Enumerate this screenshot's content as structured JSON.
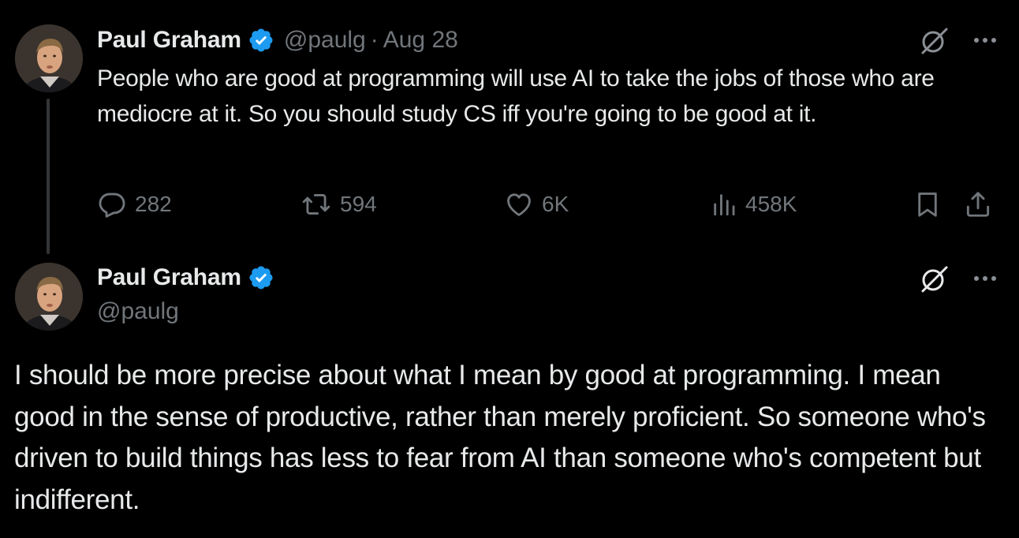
{
  "tweet1": {
    "author_name": "Paul Graham",
    "handle": "@paulg",
    "separator": "·",
    "date": "Aug 28",
    "text": "People who are good at programming will use AI to take the jobs of those who are mediocre at it. So you should study CS iff you're going to be good at it.",
    "stats": {
      "replies": "282",
      "reposts": "594",
      "likes": "6K",
      "views": "458K"
    }
  },
  "tweet2": {
    "author_name": "Paul Graham",
    "handle": "@paulg",
    "text": "I should be more precise about what I mean by good at programming. I mean good in the sense of productive, rather than merely proficient. So someone who's driven to build things has less to fear from AI than someone who's competent but indifferent."
  },
  "icons": {
    "verified": "verified-badge-icon",
    "grok": "grok-icon",
    "more": "more-icon",
    "reply": "reply-icon",
    "repost": "repost-icon",
    "like": "heart-icon",
    "views": "views-icon",
    "bookmark": "bookmark-icon",
    "share": "share-icon"
  },
  "colors": {
    "background": "#000000",
    "text": "#e7e9ea",
    "secondary": "#71767b",
    "verified": "#1d9bf0",
    "thread_line": "#333639"
  }
}
